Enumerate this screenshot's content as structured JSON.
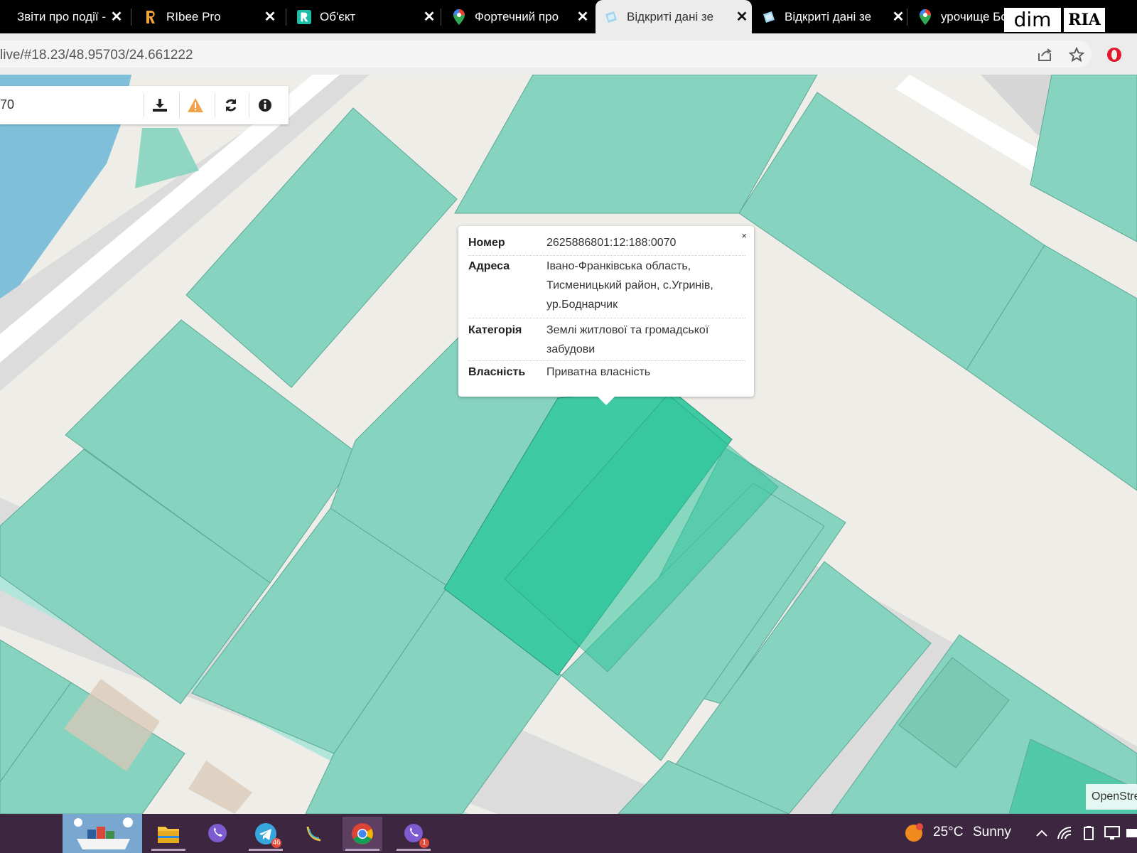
{
  "browser": {
    "tabs": [
      {
        "title": "Звіти про події -",
        "icon": "report-icon"
      },
      {
        "title": "RIbee Pro",
        "icon": "ribee-icon"
      },
      {
        "title": "Об'єкт",
        "icon": "r-logo-icon"
      },
      {
        "title": "Фортечний про",
        "icon": "map-pin-icon"
      },
      {
        "title": "Відкриті дані зе",
        "icon": "open-data-icon",
        "active": true
      },
      {
        "title": "Відкриті дані зе",
        "icon": "open-data-icon"
      },
      {
        "title": "урочище Бодн",
        "icon": "map-pin-icon"
      }
    ],
    "watermark": {
      "left": "dim",
      "right": "RIA"
    },
    "url": "live/#18.23/48.95703/24.661222"
  },
  "map": {
    "search_value": "70",
    "toolbar": [
      "download-icon",
      "warning-icon",
      "refresh-icon",
      "info-icon"
    ],
    "popup": {
      "close": "×",
      "rows": [
        {
          "key": "Номер",
          "value": "2625886801:12:188:0070"
        },
        {
          "key": "Адреса",
          "value": "Івано-Франківська область, Тисменицький район, с.Угринів, ур.Боднарчик"
        },
        {
          "key": "Категорія",
          "value": "Землі житлової та громадської забудови"
        },
        {
          "key": "Власність",
          "value": "Приватна власність"
        }
      ]
    },
    "attribution": "OpenStre",
    "colors": {
      "parcel": "#86d3bf",
      "selected": "#3ecaa2",
      "water": "#7fbfd9",
      "road": "#dcdcdc",
      "bg": "#efede8"
    }
  },
  "taskbar": {
    "apps": [
      {
        "name": "file-explorer-icon"
      },
      {
        "name": "viber-icon"
      },
      {
        "name": "telegram-icon",
        "badge": "46"
      },
      {
        "name": "cursor-app-icon"
      },
      {
        "name": "chrome-icon",
        "active": true
      },
      {
        "name": "viber-icon",
        "badge": "1"
      }
    ],
    "weather": {
      "temp": "25°C",
      "desc": "Sunny",
      "badge": "1"
    }
  }
}
